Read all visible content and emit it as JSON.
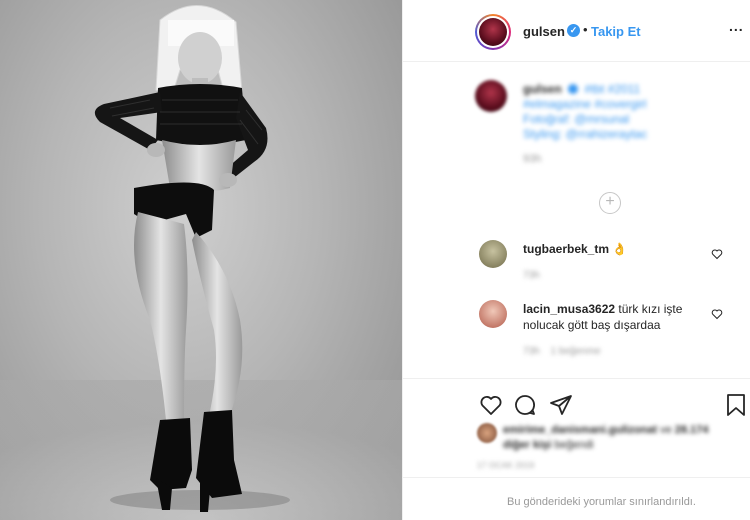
{
  "header": {
    "username": "gulsen",
    "verified_icon": "verified-badge-icon",
    "separator": "•",
    "follow_label": "Takip Et",
    "more_label": "..."
  },
  "caption": {
    "username": "gulsen",
    "line1": "#tbt #2011",
    "line2": "#elmagazine #covergirl",
    "line3": "Fotoğraf: @mrsunal",
    "line4": "Styling: @rrahizeraytac",
    "time": "93h"
  },
  "load_more_label": "+",
  "comments": [
    {
      "username": "tugbaerbek_tm",
      "text": "👌",
      "time": "73h",
      "reply": ""
    },
    {
      "username": "lacin_musa3622",
      "text": "türk kızı işte",
      "text2": "nolucak gött baş dışardaa",
      "time": "73h",
      "reply": "1 beğenme"
    }
  ],
  "likes": {
    "text_part1": "emirime_danismani.gulizonat",
    "text_connector": " ve",
    "text_part2": "28.174 diğer kişi",
    "text_suffix": " beğendi"
  },
  "date": "17 OCAK 2019",
  "restricted_text": "Bu gönderideki yorumlar sınırlandırıldı.",
  "colors": {
    "link_blue": "#3897f0",
    "text": "#262626",
    "muted": "#999999",
    "border": "#efefef"
  }
}
